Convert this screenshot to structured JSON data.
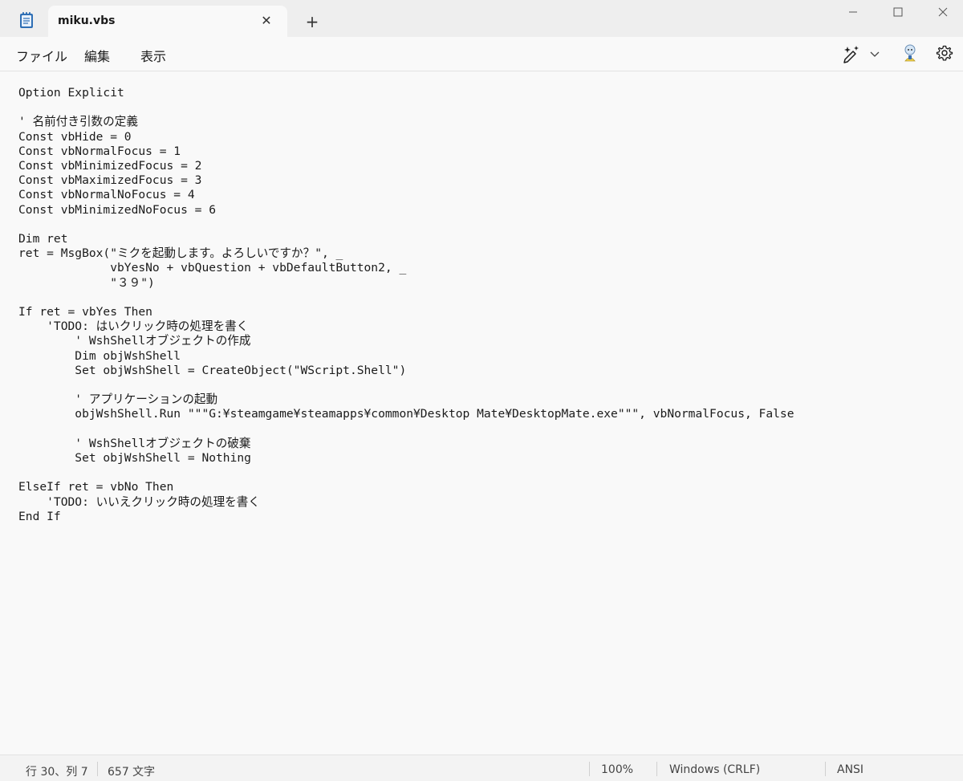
{
  "window": {
    "tab_title": "miku.vbs",
    "tab_close": "✕",
    "new_tab": "+",
    "minimize": "—",
    "maximize": "☐",
    "close": "✕"
  },
  "menu": {
    "file": "ファイル",
    "edit": "編集",
    "view": "表示"
  },
  "toolbar": {
    "copilot_icon": "sparkle-pen-icon",
    "avatar_icon": "user-avatar-icon",
    "settings_icon": "gear-icon"
  },
  "editor": {
    "content": "Option Explicit\n\n' 名前付き引数の定義\nConst vbHide = 0\nConst vbNormalFocus = 1\nConst vbMinimizedFocus = 2\nConst vbMaximizedFocus = 3\nConst vbNormalNoFocus = 4\nConst vbMinimizedNoFocus = 6\n\nDim ret\nret = MsgBox(\"ミクを起動します。よろしいですか？\", _\n             vbYesNo + vbQuestion + vbDefaultButton2, _\n             \"３９\")\n\nIf ret = vbYes Then\n    'TODO: はいクリック時の処理を書く\n        ' WshShellオブジェクトの作成\n        Dim objWshShell\n        Set objWshShell = CreateObject(\"WScript.Shell\")\n\n        ' アプリケーションの起動\n        objWshShell.Run \"\"\"G:¥steamgame¥steamapps¥common¥Desktop Mate¥DesktopMate.exe\"\"\", vbNormalFocus, False\n\n        ' WshShellオブジェクトの破棄\n        Set objWshShell = Nothing\n\nElseIf ret = vbNo Then\n    'TODO: いいえクリック時の処理を書く\nEnd If"
  },
  "status": {
    "position": "行 30、列 7",
    "chars": "657 文字",
    "zoom": "100%",
    "line_ending": "Windows (CRLF)",
    "encoding": "ANSI"
  }
}
